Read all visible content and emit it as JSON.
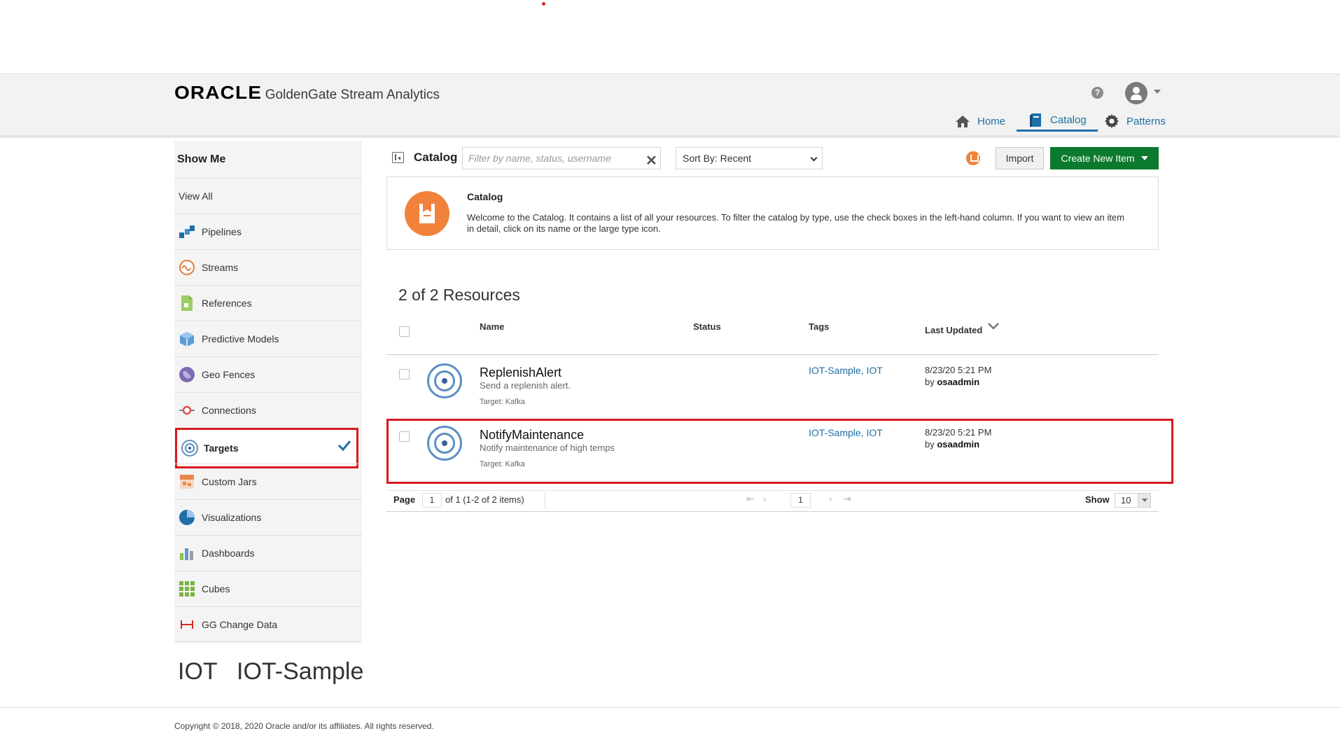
{
  "app": {
    "logo": "ORACLE",
    "product": "GoldenGate Stream Analytics"
  },
  "nav": {
    "home": "Home",
    "catalog": "Catalog",
    "patterns": "Patterns",
    "help": "?"
  },
  "sidebar": {
    "title": "Show Me",
    "view_all": "View All",
    "items": [
      {
        "label": "Pipelines",
        "icon": "pipelines-icon"
      },
      {
        "label": "Streams",
        "icon": "streams-icon"
      },
      {
        "label": "References",
        "icon": "references-icon"
      },
      {
        "label": "Predictive Models",
        "icon": "predictive-models-icon"
      },
      {
        "label": "Geo Fences",
        "icon": "geo-fences-icon"
      },
      {
        "label": "Connections",
        "icon": "connections-icon"
      },
      {
        "label": "Targets",
        "icon": "targets-icon",
        "selected": true
      },
      {
        "label": "Custom Jars",
        "icon": "custom-jars-icon"
      },
      {
        "label": "Visualizations",
        "icon": "visualizations-icon"
      },
      {
        "label": "Dashboards",
        "icon": "dashboards-icon"
      },
      {
        "label": "Cubes",
        "icon": "cubes-icon"
      },
      {
        "label": "GG Change Data",
        "icon": "gg-change-data-icon"
      }
    ],
    "tags": [
      "IOT",
      "IOT-Sample"
    ]
  },
  "toolbar": {
    "title": "Catalog",
    "filter_placeholder": "Filter by name, status, username",
    "sort_label": "Sort By: Recent",
    "import_label": "Import",
    "create_label": "Create New Item"
  },
  "welcome": {
    "title": "Catalog",
    "text": "Welcome to the Catalog. It contains a list of all your resources. To filter the catalog by type, use the check boxes in the left-hand column. If you want to view an item in detail, click on its name or the large type icon."
  },
  "resources": {
    "count_label": "2 of 2 Resources",
    "columns": {
      "name": "Name",
      "status": "Status",
      "tags": "Tags",
      "last_updated": "Last Updated"
    },
    "rows": [
      {
        "name": "ReplenishAlert",
        "description": "Send a replenish alert.",
        "target": "Target: Kafka",
        "status": "",
        "tags": "IOT-Sample, IOT",
        "date": "8/23/20 5:21 PM",
        "by_prefix": "by",
        "by_user": "osaadmin"
      },
      {
        "name": "NotifyMaintenance",
        "description": "Notify maintenance of high temps",
        "target": "Target: Kafka",
        "status": "",
        "tags": "IOT-Sample, IOT",
        "date": "8/23/20 5:21 PM",
        "by_prefix": "by",
        "by_user": "osaadmin"
      }
    ]
  },
  "pager": {
    "page_label": "Page",
    "page_value": "1",
    "page_of": "of 1 (1-2 of 2 items)",
    "current_page": "1",
    "show_label": "Show",
    "show_value": "10"
  },
  "footer": {
    "copyright": "Copyright © 2018, 2020 Oracle and/or its affiliates. All rights reserved."
  },
  "colors": {
    "accent_blue": "#1d6fa5",
    "create_green": "#0b7a2e",
    "highlight_red": "#d71920",
    "catalog_orange": "#f0823b"
  }
}
